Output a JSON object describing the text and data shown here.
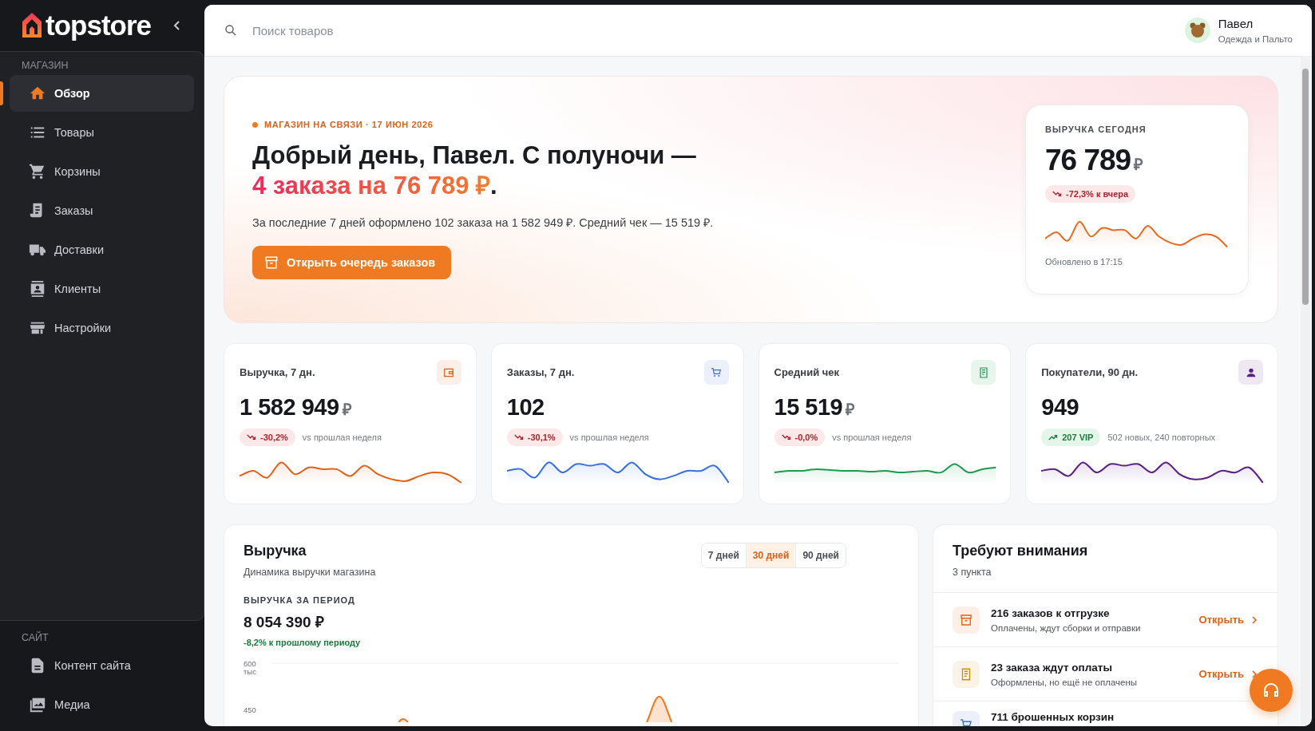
{
  "sidebar": {
    "logo": "topstore",
    "sections": [
      {
        "title": "МАГАЗИН",
        "items": [
          {
            "label": "Обзор",
            "selected": true
          },
          {
            "label": "Товары",
            "selected": false
          },
          {
            "label": "Корзины",
            "selected": false
          },
          {
            "label": "Заказы",
            "selected": false
          },
          {
            "label": "Доставки",
            "selected": false
          },
          {
            "label": "Клиенты",
            "selected": false
          },
          {
            "label": "Настройки",
            "selected": false
          }
        ]
      },
      {
        "title": "САЙТ",
        "items": [
          {
            "label": "Контент сайта",
            "selected": false
          },
          {
            "label": "Медиа",
            "selected": false
          }
        ]
      }
    ]
  },
  "topbar": {
    "search": {
      "placeholder": "Поиск товаров"
    },
    "user": {
      "name": "Павел",
      "store": "Одежда и Пальто"
    }
  },
  "hero": {
    "status": "МАГАЗИН НА СВЯЗИ · 17 ИЮН 2026",
    "heading": "Добрый день, Павел. С полуночи — ",
    "heading_highlight": "4 заказа на 76 789 ₽",
    "heading_end": ".",
    "summary": "За последние 7 дней оформлено 102 заказа на 1 582 949 ₽. Средний чек — 15 519 ₽.",
    "button": "Открыть очередь заказов",
    "today": {
      "label": "ВЫРУЧКА СЕГОДНЯ",
      "value": "76 789",
      "currency": "₽",
      "change": "-72,3% к вчера",
      "rising": false,
      "updated": "Обновлено в 17:15"
    }
  },
  "stats": [
    {
      "label": "Выручка, 7 дн.",
      "value": "1 582 949",
      "currency": "₽",
      "change": "-30,2%",
      "rising": false,
      "note": "vs прошлая неделя",
      "color": "#e0621b"
    },
    {
      "label": "Заказы, 7 дн.",
      "value": "102",
      "change": "-30,1%",
      "rising": false,
      "note": "vs прошлая неделя",
      "color": "#3a6fe0"
    },
    {
      "label": "Средний чек",
      "value": "15 519",
      "currency": "₽",
      "change": "-0,0%",
      "rising": false,
      "note": "vs прошлая неделя",
      "color": "#1f9a4e"
    },
    {
      "label": "Покупатели, 90 дн.",
      "value": "949",
      "change": "207 VIP",
      "rising": true,
      "note": "502 новых, 240 повторных",
      "color": "#5b1f86"
    }
  ],
  "revenue": {
    "title": "Выручка",
    "subtitle": "Динамика выручки магазина",
    "periods": [
      {
        "label": "7 дней",
        "selected": false
      },
      {
        "label": "30 дней",
        "selected": true
      },
      {
        "label": "90 дней",
        "selected": false
      }
    ],
    "period_label": "ВЫРУЧКА ЗА ПЕРИОД",
    "total": "8 054 390 ₽",
    "change": "-8,2% к прошлому периоду",
    "y_labels": [
      "600 тыс",
      "450"
    ]
  },
  "attention": {
    "title": "Требуют внимания",
    "count": "3 пункта",
    "items": [
      {
        "title": "216 заказов к отгрузке",
        "subtitle": "Оплачены, ждут сборки и отправки",
        "action": "Открыть",
        "color": "#e0621b"
      },
      {
        "title": "23 заказа ждут оплаты",
        "subtitle": "Оформлены, но ещё не оплачены",
        "action": "Открыть",
        "color": "#c9910a"
      },
      {
        "title": "711 брошенных корзин",
        "color": "#3a6fe0"
      }
    ]
  }
}
